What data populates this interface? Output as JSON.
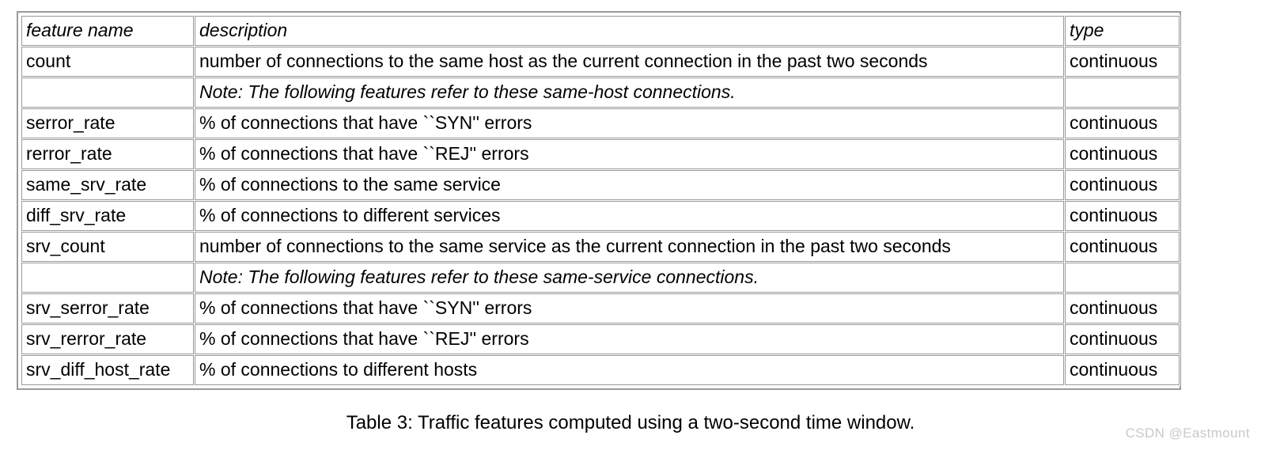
{
  "table": {
    "columns": [
      {
        "key": "feature_name",
        "label": "feature name"
      },
      {
        "key": "description",
        "label": "description"
      },
      {
        "key": "type",
        "label": "type"
      }
    ],
    "rows": [
      {
        "kind": "data",
        "feature_name": "count",
        "description": "number of connections to the same host as the current connection in the past two seconds",
        "type": "continuous"
      },
      {
        "kind": "note",
        "feature_name": "",
        "description": "Note: The following  features refer to these same-host connections.",
        "type": ""
      },
      {
        "kind": "data",
        "feature_name": "serror_rate",
        "description": "% of connections that have ``SYN'' errors",
        "type": "continuous"
      },
      {
        "kind": "data",
        "feature_name": "rerror_rate",
        "description": "% of connections that have ``REJ'' errors",
        "type": "continuous"
      },
      {
        "kind": "data",
        "feature_name": "same_srv_rate",
        "description": "% of connections to the same service",
        "type": "continuous"
      },
      {
        "kind": "data",
        "feature_name": "diff_srv_rate",
        "description": "% of connections to different services",
        "type": "continuous"
      },
      {
        "kind": "data",
        "feature_name": "srv_count",
        "description": "number of connections to the same service as the current connection in the past two seconds",
        "type": "continuous"
      },
      {
        "kind": "note",
        "feature_name": "",
        "description": "Note: The following features refer to these same-service connections.",
        "type": ""
      },
      {
        "kind": "data",
        "feature_name": "srv_serror_rate",
        "description": "% of connections that have ``SYN'' errors",
        "type": "continuous"
      },
      {
        "kind": "data",
        "feature_name": "srv_rerror_rate",
        "description": "% of connections that have ``REJ'' errors",
        "type": "continuous"
      },
      {
        "kind": "data",
        "feature_name": "srv_diff_host_rate",
        "description": "% of connections to different hosts",
        "type": "continuous"
      }
    ]
  },
  "caption": "Table 3: Traffic features computed using a two-second time window.",
  "watermark": "CSDN @Eastmount",
  "colors": {
    "border": "#9a9a9a",
    "text": "#000000",
    "background": "#ffffff",
    "watermark": "#c9c9c9"
  }
}
